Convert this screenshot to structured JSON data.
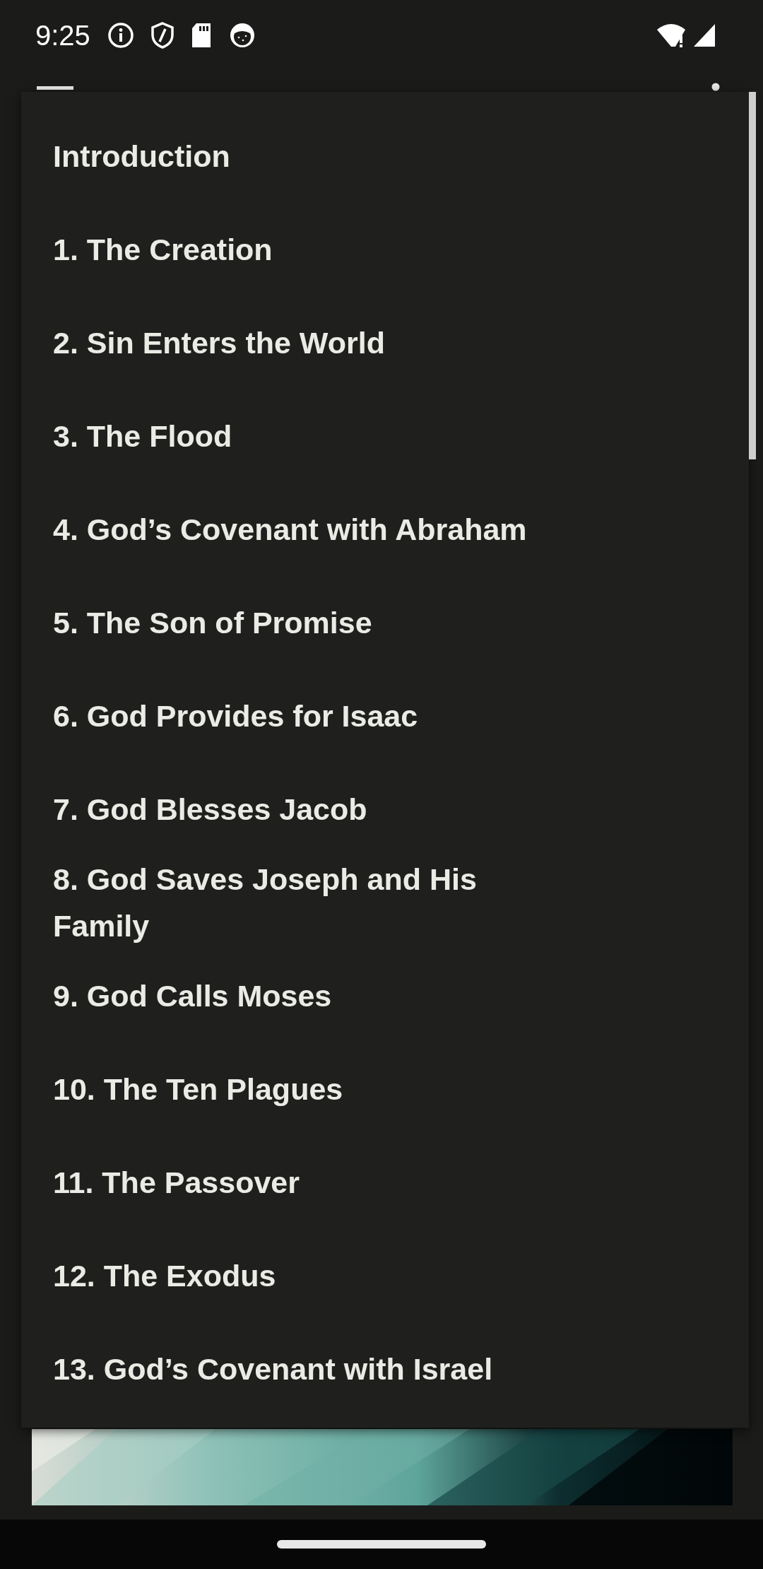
{
  "status_bar": {
    "time": "9:25"
  },
  "menu": {
    "items": [
      {
        "label": "Introduction"
      },
      {
        "label": "1. The Creation"
      },
      {
        "label": "2. Sin Enters the World"
      },
      {
        "label": "3. The Flood"
      },
      {
        "label": "4. God’s Covenant with Abraham"
      },
      {
        "label": "5. The Son of Promise"
      },
      {
        "label": "6. God Provides for Isaac"
      },
      {
        "label": "7. God Blesses Jacob"
      },
      {
        "label": "8. God Saves Joseph and His Family"
      },
      {
        "label": "9. God Calls Moses"
      },
      {
        "label": "10. The Ten Plagues"
      },
      {
        "label": "11. The Passover"
      },
      {
        "label": "12. The Exodus"
      },
      {
        "label": "13. God’s Covenant with Israel"
      }
    ]
  }
}
